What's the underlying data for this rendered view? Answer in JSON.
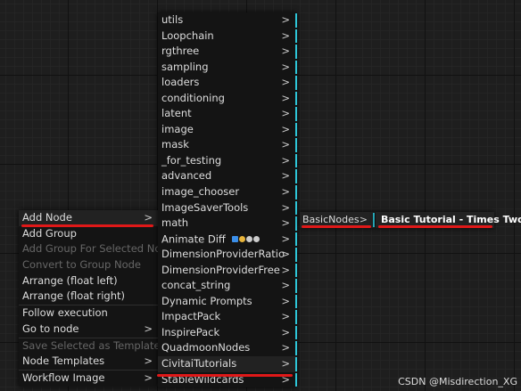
{
  "context_menu": {
    "items": [
      {
        "label": "Add Node",
        "arrow": ">"
      },
      {
        "label": "Add Group"
      },
      {
        "label": "Add Group For Selected Nodes"
      },
      {
        "label": "Convert to Group Node"
      },
      {
        "label": "Arrange (float left)"
      },
      {
        "label": "Arrange (float right)"
      },
      {
        "label": "Follow execution"
      },
      {
        "label": "Go to node",
        "arrow": ">"
      },
      {
        "label": "Save Selected as Template"
      },
      {
        "label": "Node Templates",
        "arrow": ">"
      },
      {
        "label": "Workflow Image",
        "arrow": ">"
      }
    ]
  },
  "category_menu": {
    "items": [
      {
        "label": "utils",
        "arrow": ">"
      },
      {
        "label": "Loopchain",
        "arrow": ">"
      },
      {
        "label": "rgthree",
        "arrow": ">"
      },
      {
        "label": "sampling",
        "arrow": ">"
      },
      {
        "label": "loaders",
        "arrow": ">"
      },
      {
        "label": "conditioning",
        "arrow": ">"
      },
      {
        "label": "latent",
        "arrow": ">"
      },
      {
        "label": "image",
        "arrow": ">"
      },
      {
        "label": "mask",
        "arrow": ">"
      },
      {
        "label": "_for_testing",
        "arrow": ">"
      },
      {
        "label": "advanced",
        "arrow": ">"
      },
      {
        "label": "image_chooser",
        "arrow": ">"
      },
      {
        "label": "ImageSaverTools",
        "arrow": ">"
      },
      {
        "label": "math",
        "arrow": ">"
      },
      {
        "label": "Animate Diff",
        "arrow": ">"
      },
      {
        "label": "DimensionProviderRatio",
        "arrow": ">"
      },
      {
        "label": "DimensionProviderFree",
        "arrow": ">"
      },
      {
        "label": "concat_string",
        "arrow": ">"
      },
      {
        "label": "Dynamic Prompts",
        "arrow": ">"
      },
      {
        "label": "ImpactPack",
        "arrow": ">"
      },
      {
        "label": "InspirePack",
        "arrow": ">"
      },
      {
        "label": "QuadmoonNodes",
        "arrow": ">"
      },
      {
        "label": "CivitaiTutorials",
        "arrow": ">"
      },
      {
        "label": "StableWildcards",
        "arrow": ">"
      }
    ]
  },
  "basic_menu": {
    "label": "BasicNodes",
    "arrow": ">"
  },
  "tutorial_menu": {
    "label": "Basic Tutorial - Times Two"
  },
  "watermark": "CSDN @Misdirection_XG",
  "colors": {
    "accent": "#2ec6d8",
    "highlight_line": "#e01818",
    "menu_bg": "#141414"
  }
}
